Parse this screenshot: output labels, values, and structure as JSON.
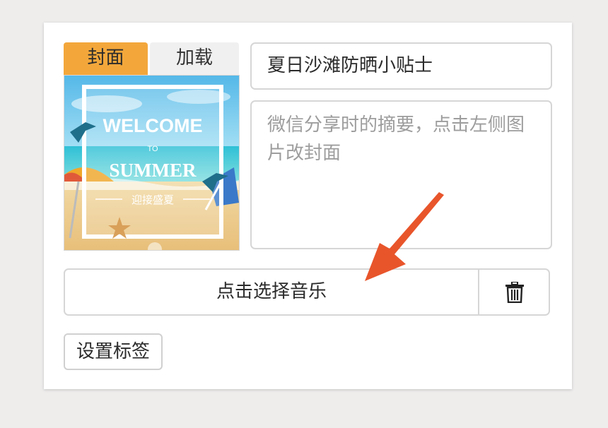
{
  "cover_tabs": {
    "cover_label": "封面",
    "load_label": "加载",
    "active": "封面",
    "active_color": "#f3a73b"
  },
  "cover_image": {
    "line1": "WELCOME",
    "line2": "TO",
    "line3": "SUMMER",
    "line4": "迎接盛夏"
  },
  "form": {
    "title_value": "夏日沙滩防晒小贴士",
    "summary_placeholder": "微信分享时的摘要，点击左侧图片改封面"
  },
  "music": {
    "select_label": "点击选择音乐",
    "delete_icon": "trash-icon"
  },
  "tags": {
    "set_tags_label": "设置标签"
  },
  "annotation": {
    "arrow_color": "#e8552b"
  }
}
